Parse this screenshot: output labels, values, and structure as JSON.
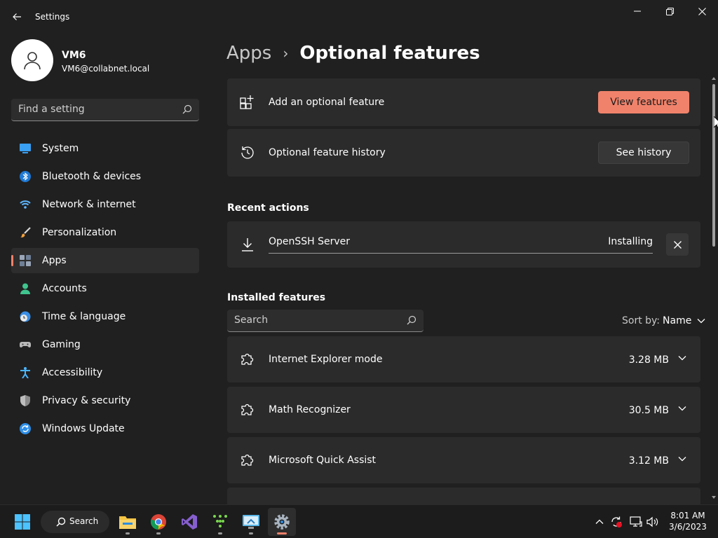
{
  "window": {
    "title": "Settings"
  },
  "profile": {
    "name": "VM6",
    "email": "VM6@collabnet.local"
  },
  "sidebar": {
    "search_placeholder": "Find a setting",
    "items": [
      {
        "label": "System",
        "icon": "monitor-icon"
      },
      {
        "label": "Bluetooth & devices",
        "icon": "bluetooth-icon"
      },
      {
        "label": "Network & internet",
        "icon": "wifi-icon"
      },
      {
        "label": "Personalization",
        "icon": "brush-icon"
      },
      {
        "label": "Apps",
        "icon": "apps-icon",
        "active": true
      },
      {
        "label": "Accounts",
        "icon": "person-icon"
      },
      {
        "label": "Time & language",
        "icon": "clock-globe-icon"
      },
      {
        "label": "Gaming",
        "icon": "gamepad-icon"
      },
      {
        "label": "Accessibility",
        "icon": "accessibility-icon"
      },
      {
        "label": "Privacy & security",
        "icon": "shield-icon"
      },
      {
        "label": "Windows Update",
        "icon": "update-icon"
      }
    ]
  },
  "breadcrumb": {
    "parent": "Apps",
    "separator": "›",
    "current": "Optional features"
  },
  "add_feature": {
    "label": "Add an optional feature",
    "button": "View features"
  },
  "history": {
    "label": "Optional feature history",
    "button": "See history"
  },
  "recent": {
    "title": "Recent actions",
    "items": [
      {
        "name": "OpenSSH Server",
        "status": "Installing",
        "progress_percent": 0
      }
    ]
  },
  "installed": {
    "title": "Installed features",
    "search_placeholder": "Search",
    "sort_label": "Sort by:",
    "sort_value": "Name",
    "items": [
      {
        "name": "Internet Explorer mode",
        "size": "3.28 MB"
      },
      {
        "name": "Math Recognizer",
        "size": "30.5 MB"
      },
      {
        "name": "Microsoft Quick Assist",
        "size": "3.12 MB"
      }
    ]
  },
  "taskbar": {
    "search_label": "Search",
    "time": "8:01 AM",
    "date": "3/6/2023"
  },
  "colors": {
    "accent": "#f0826b",
    "background": "#202020",
    "card": "#2b2b2b"
  }
}
